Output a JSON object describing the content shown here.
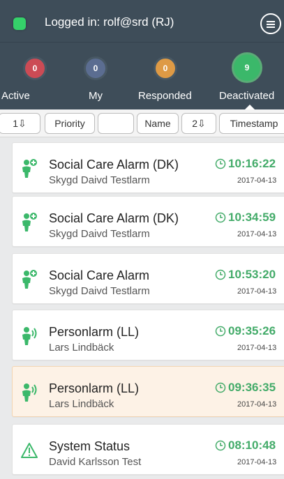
{
  "header": {
    "logged_in_text": "Logged in: rolf@srd (RJ)"
  },
  "counters": [
    {
      "count": "0",
      "label": "Active",
      "color": "#cc4b55"
    },
    {
      "count": "0",
      "label": "My",
      "color": "#5b6d91"
    },
    {
      "count": "0",
      "label": "Responded",
      "color": "#de9a45"
    },
    {
      "count": "9",
      "label": "Deactivated",
      "color": "#3bb86a"
    }
  ],
  "sortbar": [
    {
      "label": "1⇩"
    },
    {
      "label": "Priority"
    },
    {
      "label": ""
    },
    {
      "label": "Name"
    },
    {
      "label": "2⇩"
    },
    {
      "label": "Timestamp"
    }
  ],
  "alarms": [
    {
      "title": "Social Care Alarm (DK)",
      "subtitle": "Skygd Daivd Testlarm",
      "time": "10:16:22",
      "date": "2017-04-13",
      "icon": "person-plus-icon"
    },
    {
      "title": "Social Care Alarm (DK)",
      "subtitle": "Skygd Daivd Testlarm",
      "time": "10:34:59",
      "date": "2017-04-13",
      "icon": "person-plus-icon"
    },
    {
      "title": "Social Care Alarm",
      "subtitle": "Skygd Daivd Testlarm",
      "time": "10:53:20",
      "date": "2017-04-13",
      "icon": "person-plus-icon"
    },
    {
      "title": "Personlarm (LL)",
      "subtitle": "Lars Lindbäck",
      "time": "09:35:26",
      "date": "2017-04-13",
      "icon": "person-alert-icon"
    },
    {
      "title": "Personlarm (LL)",
      "subtitle": "Lars Lindbäck",
      "time": "09:36:35",
      "date": "2017-04-13",
      "icon": "person-alert-icon"
    },
    {
      "title": "System Status",
      "subtitle": "David Karlsson Test",
      "time": "08:10:48",
      "date": "2017-04-13",
      "icon": "warning-triangle-icon"
    }
  ],
  "colors": {
    "header_bg": "#3e4d59",
    "accent_green": "#43ab69",
    "highlight_bg": "#fdf2e6"
  }
}
